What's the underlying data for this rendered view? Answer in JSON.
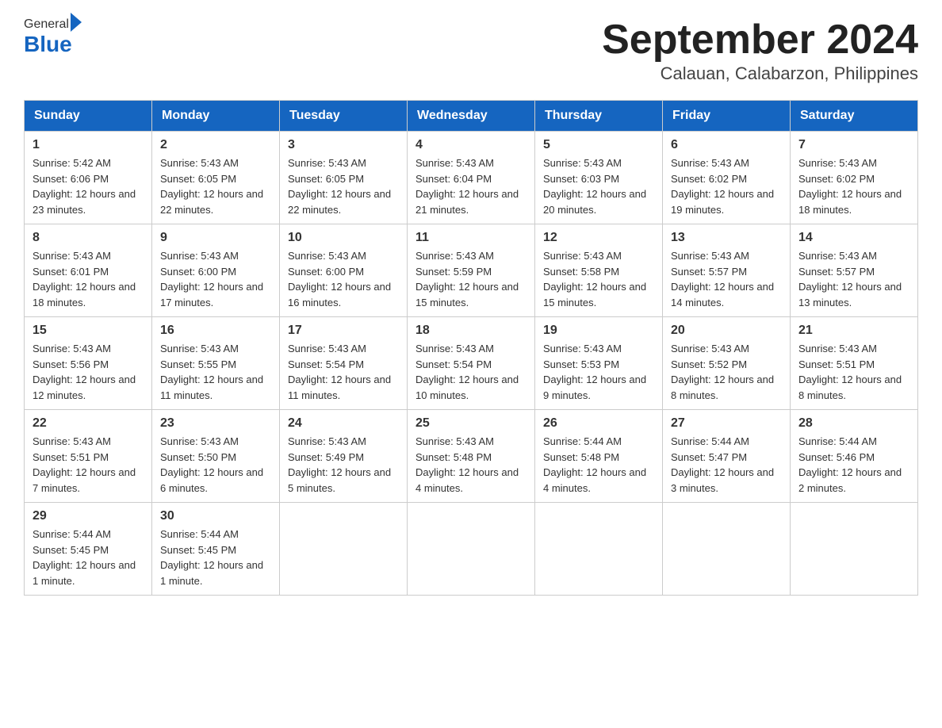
{
  "header": {
    "logo": {
      "general": "General",
      "blue": "Blue",
      "arrow_color": "#1565c0"
    },
    "title": "September 2024",
    "location": "Calauan, Calabarzon, Philippines"
  },
  "calendar": {
    "days_of_week": [
      "Sunday",
      "Monday",
      "Tuesday",
      "Wednesday",
      "Thursday",
      "Friday",
      "Saturday"
    ],
    "weeks": [
      [
        {
          "num": "1",
          "sunrise": "5:42 AM",
          "sunset": "6:06 PM",
          "daylight": "12 hours and 23 minutes."
        },
        {
          "num": "2",
          "sunrise": "5:43 AM",
          "sunset": "6:05 PM",
          "daylight": "12 hours and 22 minutes."
        },
        {
          "num": "3",
          "sunrise": "5:43 AM",
          "sunset": "6:05 PM",
          "daylight": "12 hours and 22 minutes."
        },
        {
          "num": "4",
          "sunrise": "5:43 AM",
          "sunset": "6:04 PM",
          "daylight": "12 hours and 21 minutes."
        },
        {
          "num": "5",
          "sunrise": "5:43 AM",
          "sunset": "6:03 PM",
          "daylight": "12 hours and 20 minutes."
        },
        {
          "num": "6",
          "sunrise": "5:43 AM",
          "sunset": "6:02 PM",
          "daylight": "12 hours and 19 minutes."
        },
        {
          "num": "7",
          "sunrise": "5:43 AM",
          "sunset": "6:02 PM",
          "daylight": "12 hours and 18 minutes."
        }
      ],
      [
        {
          "num": "8",
          "sunrise": "5:43 AM",
          "sunset": "6:01 PM",
          "daylight": "12 hours and 18 minutes."
        },
        {
          "num": "9",
          "sunrise": "5:43 AM",
          "sunset": "6:00 PM",
          "daylight": "12 hours and 17 minutes."
        },
        {
          "num": "10",
          "sunrise": "5:43 AM",
          "sunset": "6:00 PM",
          "daylight": "12 hours and 16 minutes."
        },
        {
          "num": "11",
          "sunrise": "5:43 AM",
          "sunset": "5:59 PM",
          "daylight": "12 hours and 15 minutes."
        },
        {
          "num": "12",
          "sunrise": "5:43 AM",
          "sunset": "5:58 PM",
          "daylight": "12 hours and 15 minutes."
        },
        {
          "num": "13",
          "sunrise": "5:43 AM",
          "sunset": "5:57 PM",
          "daylight": "12 hours and 14 minutes."
        },
        {
          "num": "14",
          "sunrise": "5:43 AM",
          "sunset": "5:57 PM",
          "daylight": "12 hours and 13 minutes."
        }
      ],
      [
        {
          "num": "15",
          "sunrise": "5:43 AM",
          "sunset": "5:56 PM",
          "daylight": "12 hours and 12 minutes."
        },
        {
          "num": "16",
          "sunrise": "5:43 AM",
          "sunset": "5:55 PM",
          "daylight": "12 hours and 11 minutes."
        },
        {
          "num": "17",
          "sunrise": "5:43 AM",
          "sunset": "5:54 PM",
          "daylight": "12 hours and 11 minutes."
        },
        {
          "num": "18",
          "sunrise": "5:43 AM",
          "sunset": "5:54 PM",
          "daylight": "12 hours and 10 minutes."
        },
        {
          "num": "19",
          "sunrise": "5:43 AM",
          "sunset": "5:53 PM",
          "daylight": "12 hours and 9 minutes."
        },
        {
          "num": "20",
          "sunrise": "5:43 AM",
          "sunset": "5:52 PM",
          "daylight": "12 hours and 8 minutes."
        },
        {
          "num": "21",
          "sunrise": "5:43 AM",
          "sunset": "5:51 PM",
          "daylight": "12 hours and 8 minutes."
        }
      ],
      [
        {
          "num": "22",
          "sunrise": "5:43 AM",
          "sunset": "5:51 PM",
          "daylight": "12 hours and 7 minutes."
        },
        {
          "num": "23",
          "sunrise": "5:43 AM",
          "sunset": "5:50 PM",
          "daylight": "12 hours and 6 minutes."
        },
        {
          "num": "24",
          "sunrise": "5:43 AM",
          "sunset": "5:49 PM",
          "daylight": "12 hours and 5 minutes."
        },
        {
          "num": "25",
          "sunrise": "5:43 AM",
          "sunset": "5:48 PM",
          "daylight": "12 hours and 4 minutes."
        },
        {
          "num": "26",
          "sunrise": "5:44 AM",
          "sunset": "5:48 PM",
          "daylight": "12 hours and 4 minutes."
        },
        {
          "num": "27",
          "sunrise": "5:44 AM",
          "sunset": "5:47 PM",
          "daylight": "12 hours and 3 minutes."
        },
        {
          "num": "28",
          "sunrise": "5:44 AM",
          "sunset": "5:46 PM",
          "daylight": "12 hours and 2 minutes."
        }
      ],
      [
        {
          "num": "29",
          "sunrise": "5:44 AM",
          "sunset": "5:45 PM",
          "daylight": "12 hours and 1 minute."
        },
        {
          "num": "30",
          "sunrise": "5:44 AM",
          "sunset": "5:45 PM",
          "daylight": "12 hours and 1 minute."
        },
        null,
        null,
        null,
        null,
        null
      ]
    ]
  }
}
